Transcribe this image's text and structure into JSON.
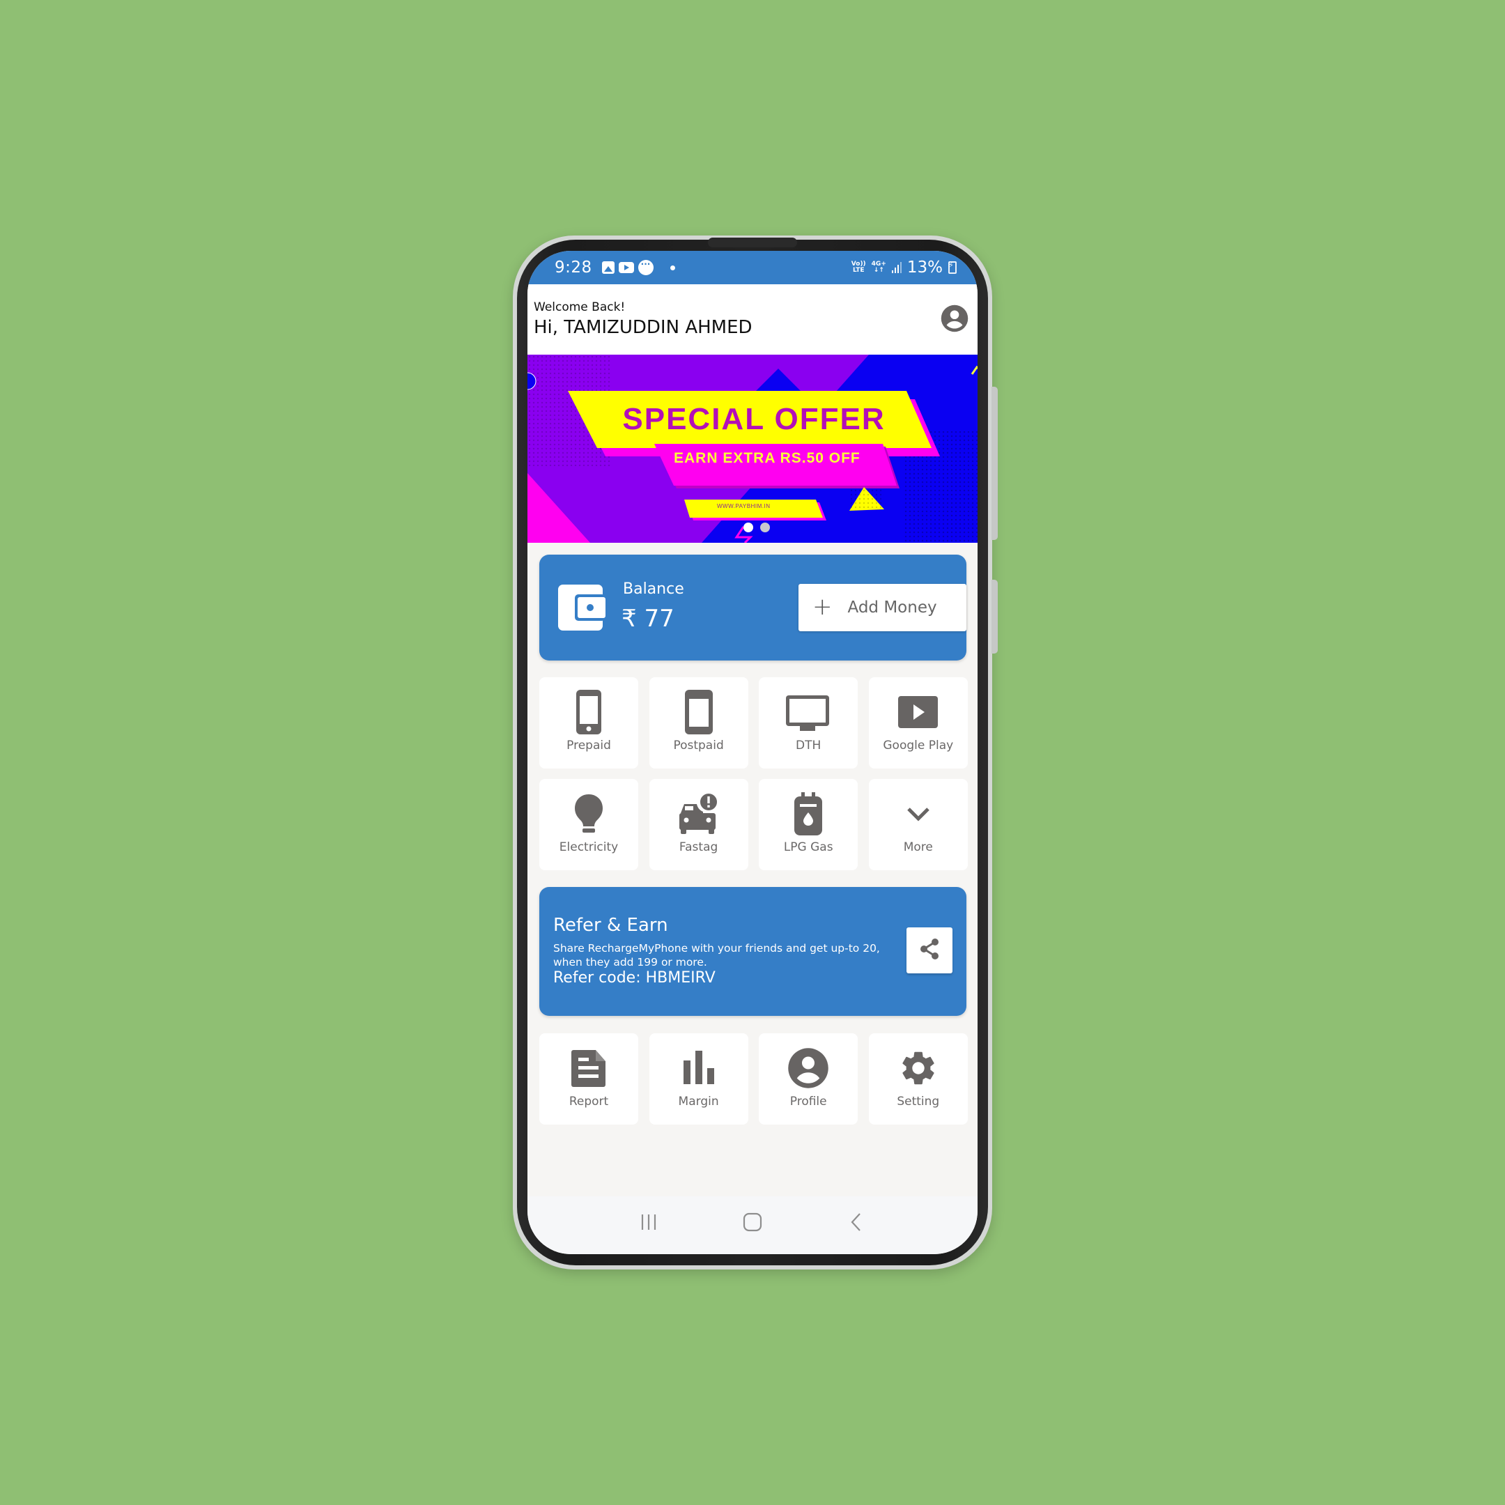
{
  "status_bar": {
    "time": "9:28",
    "notification_icons": [
      "gallery-icon",
      "youtube-icon",
      "message-icon"
    ],
    "network_volte": "Vo)) LTE",
    "network_4g": "4G+",
    "battery_percent": "13%"
  },
  "header": {
    "welcome": "Welcome Back!",
    "greeting": "Hi, TAMIZUDDIN AHMED",
    "avatar_icon": "account-circle-icon"
  },
  "banner": {
    "title": "SPECIAL OFFER",
    "subtitle": "EARN EXTRA RS.50 OFF",
    "url": "WWW.PAYBHIM.IN",
    "slide_count": 2,
    "active_slide": 1,
    "colors": {
      "purple": "#8a00f0",
      "blue": "#0a00f2",
      "yellow": "#ffff00",
      "magenta": "#ff00f0"
    }
  },
  "balance": {
    "label": "Balance",
    "value": "₹ 77",
    "add_money_label": "Add Money",
    "wallet_icon": "wallet-icon"
  },
  "services": [
    {
      "label": "Prepaid",
      "icon": "smartphone-icon"
    },
    {
      "label": "Postpaid",
      "icon": "phone-android-icon"
    },
    {
      "label": "DTH",
      "icon": "tv-icon"
    },
    {
      "label": "Google Play",
      "icon": "play-icon"
    },
    {
      "label": "Electricity",
      "icon": "lightbulb-icon"
    },
    {
      "label": "Fastag",
      "icon": "car-alert-icon"
    },
    {
      "label": "LPG Gas",
      "icon": "gas-cylinder-icon"
    },
    {
      "label": "More",
      "icon": "chevron-down-icon"
    }
  ],
  "refer": {
    "title": "Refer & Earn",
    "description": "Share RechargeMyPhone with your friends and get up-to 20, when they add 199 or more.",
    "code": "Refer code: HBMEIRV",
    "share_icon": "share-icon"
  },
  "shortcuts": [
    {
      "label": "Report",
      "icon": "report-icon"
    },
    {
      "label": "Margin",
      "icon": "bar-chart-icon"
    },
    {
      "label": "Profile",
      "icon": "profile-icon"
    },
    {
      "label": "Setting",
      "icon": "gear-icon"
    }
  ],
  "theme": {
    "primary": "#357ec7",
    "icon_gray": "#676463",
    "page_background": "#8fbf73"
  }
}
